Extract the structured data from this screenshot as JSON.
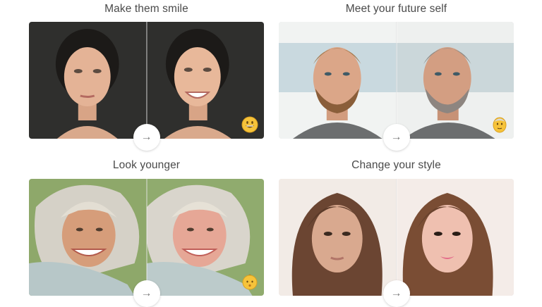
{
  "cards": [
    {
      "title": "Make them smile",
      "action": "→",
      "badge_icon": "smiling-emoji-icon"
    },
    {
      "title": "Meet your future self",
      "action": "→",
      "badge_icon": "old-man-emoji-icon"
    },
    {
      "title": "Look younger",
      "action": "→",
      "badge_icon": "baby-emoji-icon"
    },
    {
      "title": "Change your style",
      "action": "→"
    }
  ]
}
